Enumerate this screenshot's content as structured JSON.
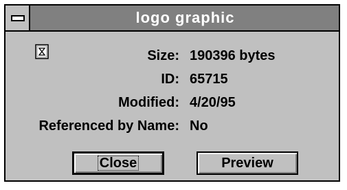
{
  "window": {
    "title": "logo graphic",
    "icon": "resource-properties-icon"
  },
  "properties": [
    {
      "label": "Size:",
      "value": "190396 bytes"
    },
    {
      "label": "ID:",
      "value": "65715"
    },
    {
      "label": "Modified:",
      "value": "4/20/95"
    },
    {
      "label": "Referenced by Name:",
      "value": "No"
    }
  ],
  "buttons": {
    "close_label": "Close",
    "preview_label": "Preview"
  }
}
